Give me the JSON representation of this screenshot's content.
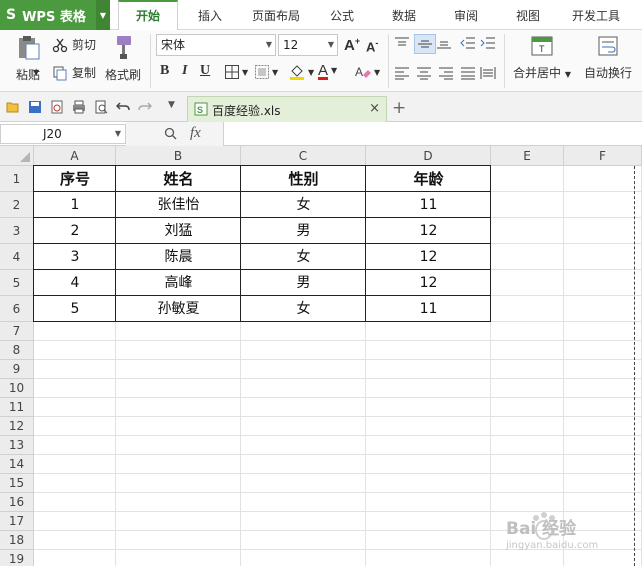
{
  "app": {
    "button_label": "WPS 表格",
    "logo": "S"
  },
  "menu_tabs": [
    {
      "label": "开始",
      "active": true
    },
    {
      "label": "插入"
    },
    {
      "label": "页面布局"
    },
    {
      "label": "公式"
    },
    {
      "label": "数据"
    },
    {
      "label": "审阅"
    },
    {
      "label": "视图"
    },
    {
      "label": "开发工具"
    }
  ],
  "ribbon": {
    "paste_label": "粘贴",
    "cut_label": "剪切",
    "copy_label": "复制",
    "format_painter_label": "格式刷",
    "font_name": "宋体",
    "font_size": "12",
    "merge_center_label": "合并居中",
    "wrap_text_label": "自动换行",
    "bold": "B",
    "italic": "I",
    "underline": "U",
    "font_color_letter": "A",
    "increase_font": "A",
    "decrease_font": "A"
  },
  "document_tab": {
    "name": "百度经验.xls"
  },
  "formula_bar": {
    "cell_ref": "J20",
    "fx_label": "fx"
  },
  "sheet": {
    "columns": [
      "A",
      "B",
      "C",
      "D",
      "E",
      "F"
    ],
    "rows": [
      "1",
      "2",
      "3",
      "4",
      "5",
      "6",
      "7",
      "8",
      "9",
      "10",
      "11",
      "12",
      "13",
      "14",
      "15",
      "16",
      "17",
      "18",
      "19"
    ],
    "headers": [
      "序号",
      "姓名",
      "性别",
      "年龄"
    ],
    "data": [
      [
        "1",
        "张佳怡",
        "女",
        "11"
      ],
      [
        "2",
        "刘猛",
        "男",
        "12"
      ],
      [
        "3",
        "陈晨",
        "女",
        "12"
      ],
      [
        "4",
        "高峰",
        "男",
        "12"
      ],
      [
        "5",
        "孙敏夏",
        "女",
        "11"
      ]
    ]
  },
  "colors": {
    "accent": "#4c9a3f",
    "header_bg": "#ececec",
    "doc_tab_bg": "#e3efd9"
  },
  "watermark": {
    "text": "Bai  经验",
    "sub": "jingyan.baidu.com"
  }
}
